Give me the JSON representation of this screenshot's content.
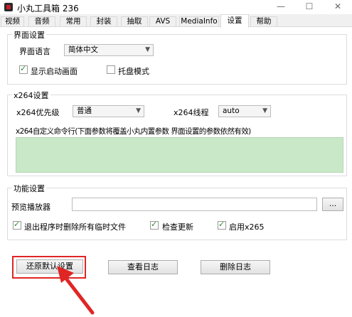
{
  "window": {
    "title": "小丸工具箱 236",
    "minimize": "—",
    "maximize": "☐",
    "close": "✕"
  },
  "tabs": [
    {
      "label": "视频",
      "active": false
    },
    {
      "label": "音频",
      "active": false
    },
    {
      "label": "常用",
      "active": false
    },
    {
      "label": "封装",
      "active": false
    },
    {
      "label": "抽取",
      "active": false
    },
    {
      "label": "AVS",
      "active": false
    },
    {
      "label": "MediaInfo",
      "active": false
    },
    {
      "label": "设置",
      "active": true
    },
    {
      "label": "帮助",
      "active": false
    }
  ],
  "interface_settings": {
    "group_title": "界面设置",
    "language_label": "界面语言",
    "language_value": "简体中文",
    "show_splash_label": "显示启动画面",
    "show_splash_checked": true,
    "tray_mode_label": "托盘模式",
    "tray_mode_checked": false
  },
  "x264_settings": {
    "group_title": "x264设置",
    "priority_label": "x264优先级",
    "priority_value": "普通",
    "threads_label": "x264线程",
    "threads_value": "auto",
    "custom_cmd_label": "x264自定义命令行(下面参数将覆盖小丸内置参数 界面设置的参数依然有效)",
    "custom_cmd_value": ""
  },
  "function_settings": {
    "group_title": "功能设置",
    "preview_player_label": "预览播放器",
    "preview_player_value": "",
    "browse_label": "...",
    "delete_temp_label": "退出程序时删除所有临时文件",
    "delete_temp_checked": true,
    "check_update_label": "检查更新",
    "check_update_checked": true,
    "enable_x265_label": "启用x265",
    "enable_x265_checked": true
  },
  "buttons": {
    "restore_defaults": "还原默认设置",
    "view_log": "查看日志",
    "delete_log": "删除日志"
  },
  "colors": {
    "highlight": "#e02525",
    "command_area": "#c8e8c8",
    "check_mark": "#2c8a2c"
  }
}
